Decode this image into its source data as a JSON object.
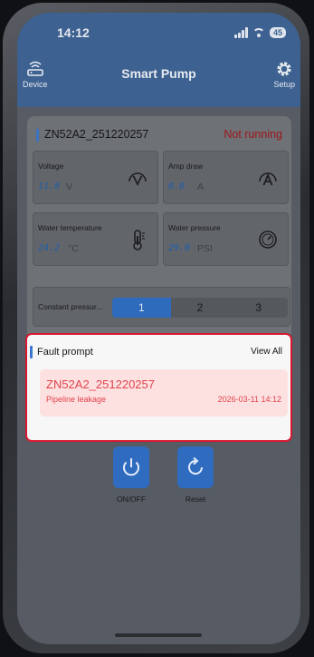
{
  "status_bar": {
    "time": "14:12",
    "battery": "45"
  },
  "header": {
    "title": "Smart Pump",
    "device_label": "Device",
    "setup_label": "Setup"
  },
  "device": {
    "id": "ZN52A2_251220257",
    "status": "Not running"
  },
  "metrics": {
    "voltage": {
      "label": "Voltage",
      "value": "11.8",
      "unit": "V"
    },
    "amp_draw": {
      "label": "Amp draw",
      "value": "0.0",
      "unit": "A"
    },
    "water_temperature": {
      "label": "Water temperature",
      "value": "24.2",
      "unit": "°C"
    },
    "water_pressure": {
      "label": "Water pressure",
      "value": "29.0",
      "unit": "PSI"
    }
  },
  "mode": {
    "label": "Constant pressur...",
    "options": [
      "1",
      "2",
      "3"
    ],
    "selected": "1"
  },
  "fault": {
    "title": "Fault prompt",
    "view_all": "View All",
    "item": {
      "device": "ZN52A2_251220257",
      "description": "Pipeline leakage",
      "time": "2026-03-11 14:12"
    }
  },
  "actions": {
    "power_label": "ON/OFF",
    "reset_label": "Reset"
  },
  "colors": {
    "accent": "#3b78d0",
    "alert": "#d6172f",
    "fault_text": "#e0424a",
    "status_text": "#9e1717"
  }
}
